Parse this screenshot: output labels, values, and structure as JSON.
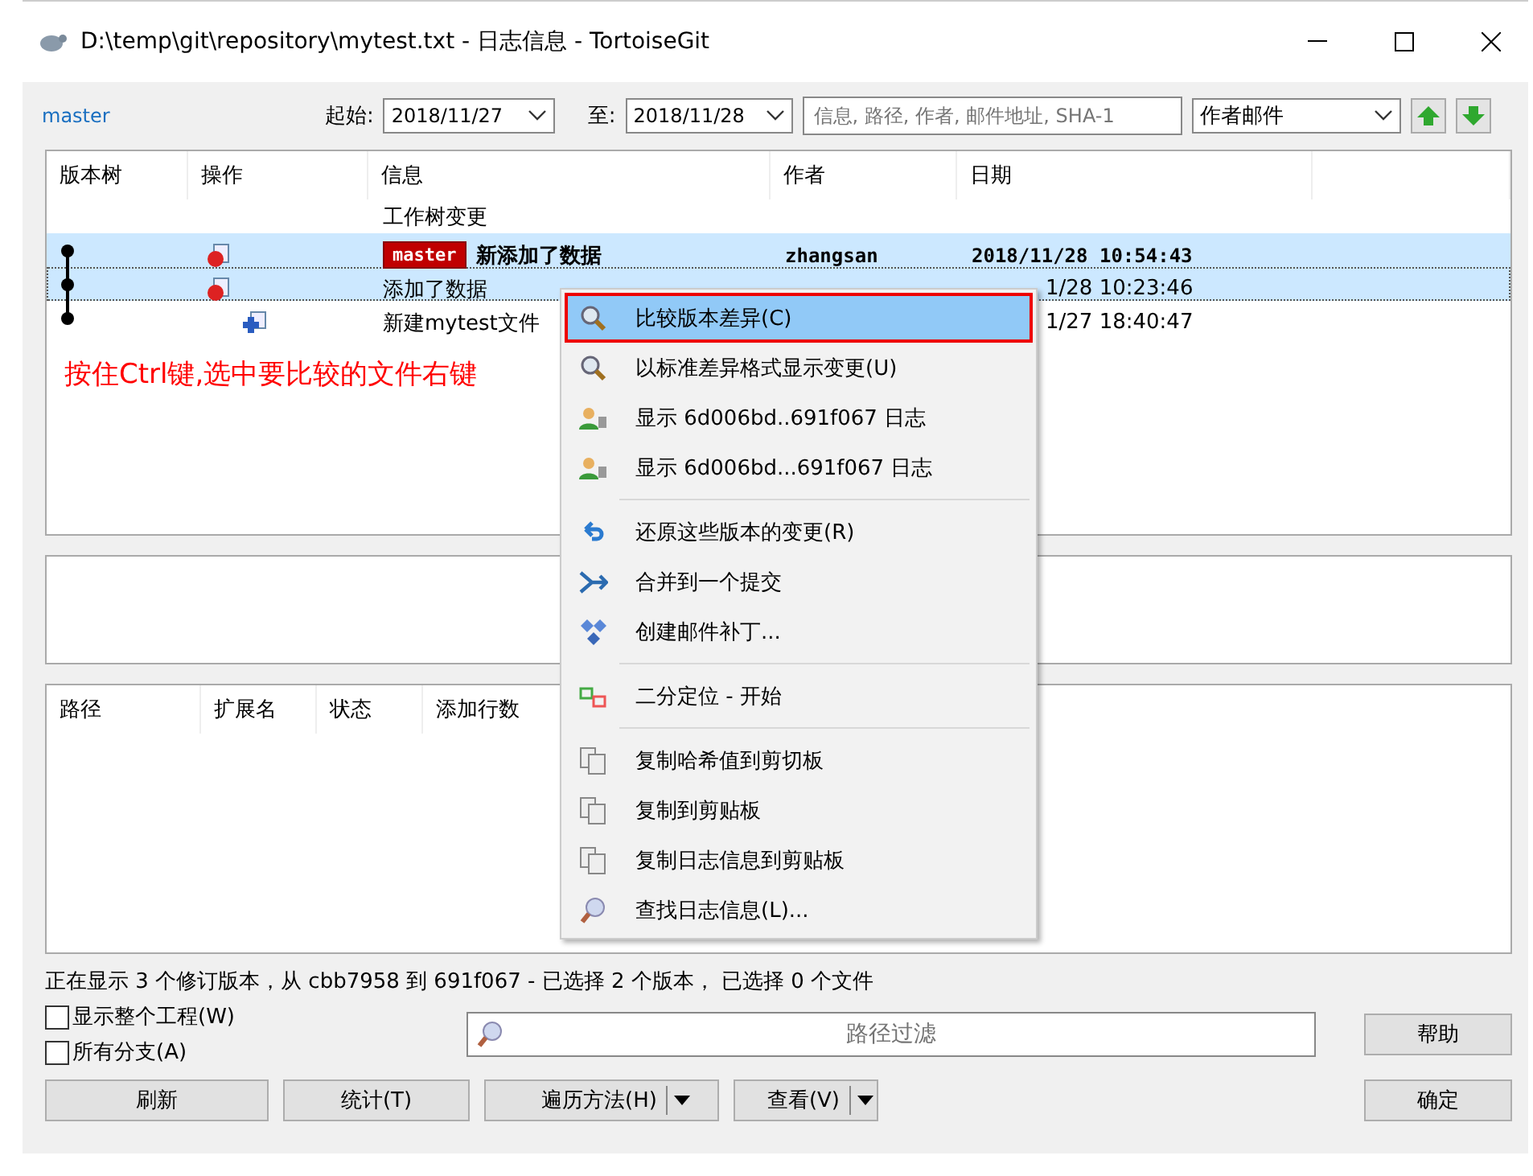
{
  "window": {
    "title": "D:\\temp\\git\\repository\\mytest.txt - 日志信息 - TortoiseGit"
  },
  "toolbar": {
    "branch": "master",
    "from_label": "起始:",
    "from_date": "2018/11/27",
    "to_label": "至:",
    "to_date": "2018/11/28",
    "search_placeholder": "信息, 路径, 作者, 邮件地址, SHA-1",
    "search_field": "作者邮件"
  },
  "log": {
    "columns": [
      "版本树",
      "操作",
      "信息",
      "作者",
      "日期"
    ],
    "rows": [
      {
        "kind": "worktree",
        "message": "工作树变更",
        "selected": false
      },
      {
        "kind": "modified",
        "branch_tag": "master",
        "message": "新添加了数据",
        "author": "zhangsan",
        "date": "2018/11/28 10:54:43",
        "selected": true,
        "head": true,
        "focused": false
      },
      {
        "kind": "modified",
        "message": "添加了数据",
        "date": "1/28 10:23:46",
        "selected": true,
        "head": false,
        "focused": true
      },
      {
        "kind": "added",
        "message": "新建mytest文件",
        "date": "1/27 18:40:47",
        "selected": false,
        "head": false,
        "focused": false
      }
    ]
  },
  "annotation": "按住Ctrl键,选中要比较的文件右键",
  "files": {
    "columns": [
      "路径",
      "扩展名",
      "状态",
      "添加行数"
    ]
  },
  "status_bar": "正在显示 3 个修订版本，从 cbb7958 到 691f067 - 已选择 2 个版本， 已选择 0 个文件",
  "options": [
    {
      "label": "显示整个工程(W)",
      "checked": false
    },
    {
      "label": "所有分支(A)",
      "checked": false
    }
  ],
  "filter": {
    "placeholder": "路径过滤"
  },
  "help_button": "帮助",
  "buttons": [
    {
      "label": "刷新",
      "kind": "plain"
    },
    {
      "label": "统计(T)",
      "kind": "plain"
    },
    {
      "label": "遍历方法(H)",
      "kind": "split"
    },
    {
      "label": "查看(V)",
      "kind": "split"
    }
  ],
  "ok_button": "确定",
  "context_menu": [
    {
      "kind": "compare",
      "label": "比较版本差异(C)",
      "selected": true,
      "annotated": true
    },
    {
      "kind": "compare",
      "label": "以标准差异格式显示变更(U)",
      "selected": false,
      "annotated": false
    },
    {
      "kind": "log",
      "label": "显示 6d006bd..691f067 日志",
      "selected": false,
      "annotated": false
    },
    {
      "kind": "log",
      "label": "显示 6d006bd...691f067 日志",
      "selected": false,
      "annotated": false
    },
    {
      "kind": "separator"
    },
    {
      "kind": "revert",
      "label": "还原这些版本的变更(R)",
      "selected": false,
      "annotated": false
    },
    {
      "kind": "squash",
      "label": "合并到一个提交",
      "selected": false,
      "annotated": false
    },
    {
      "kind": "patch",
      "label": "创建邮件补丁...",
      "selected": false,
      "annotated": false
    },
    {
      "kind": "separator"
    },
    {
      "kind": "bisect",
      "label": "二分定位 - 开始",
      "selected": false,
      "annotated": false
    },
    {
      "kind": "separator"
    },
    {
      "kind": "copy",
      "label": "复制哈希值到剪切板",
      "selected": false,
      "annotated": false
    },
    {
      "kind": "copy",
      "label": "复制到剪贴板",
      "selected": false,
      "annotated": false
    },
    {
      "kind": "copy",
      "label": "复制日志信息到剪贴板",
      "selected": false,
      "annotated": false
    },
    {
      "kind": "find",
      "label": "查找日志信息(L)...",
      "selected": false,
      "annotated": false
    }
  ]
}
